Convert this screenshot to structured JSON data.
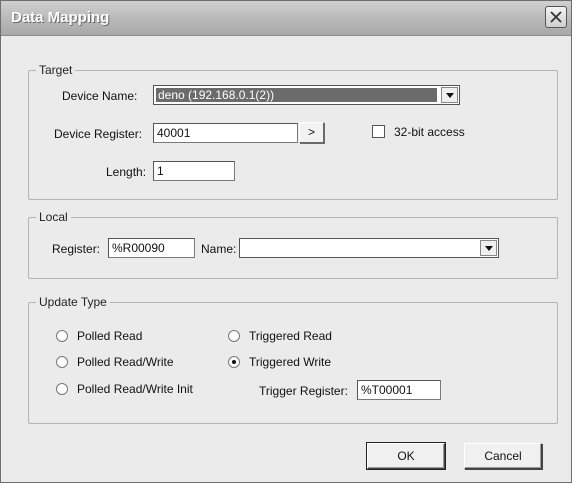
{
  "window": {
    "title": "Data Mapping"
  },
  "target": {
    "legend": "Target",
    "device_name_label": "Device Name:",
    "device_name_value": "deno (192.168.0.1(2))",
    "device_register_label": "Device Register:",
    "device_register_value": "40001",
    "browse_label": ">",
    "access_label": "32-bit access",
    "access_checked": false,
    "length_label": "Length:",
    "length_value": "1"
  },
  "local": {
    "legend": "Local",
    "register_label": "Register:",
    "register_value": "%R00090",
    "name_label": "Name:",
    "name_value": ""
  },
  "update_type": {
    "legend": "Update Type",
    "options": [
      {
        "label": "Polled Read",
        "checked": false
      },
      {
        "label": "Polled Read/Write",
        "checked": false
      },
      {
        "label": "Polled Read/Write Init",
        "checked": false
      },
      {
        "label": "Triggered Read",
        "checked": false
      },
      {
        "label": "Triggered Write",
        "checked": true
      }
    ],
    "trigger_register_label": "Trigger Register:",
    "trigger_register_value": "%T00001"
  },
  "buttons": {
    "ok": "OK",
    "cancel": "Cancel"
  }
}
